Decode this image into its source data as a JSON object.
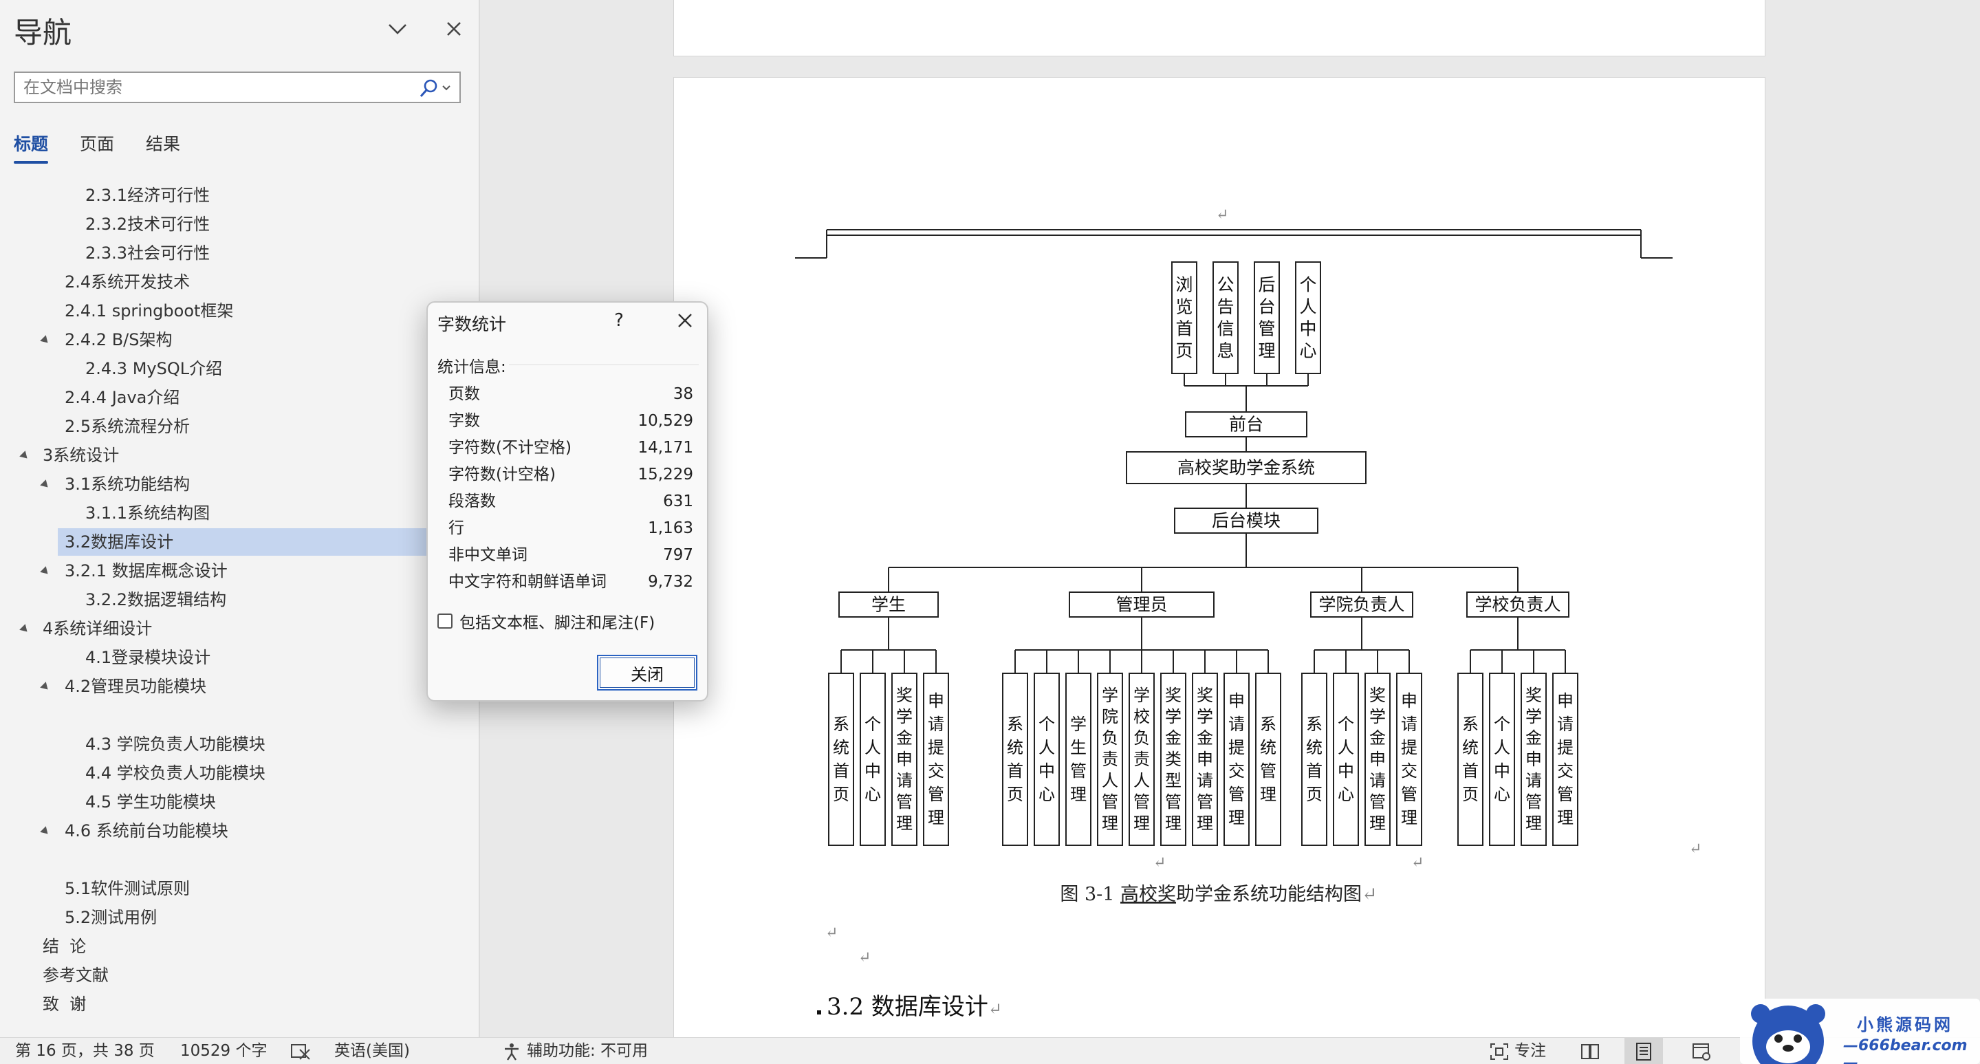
{
  "nav": {
    "title": "导航",
    "search_placeholder": "在文档中搜索",
    "tabs": [
      "标题",
      "页面",
      "结果"
    ],
    "headings": [
      {
        "label": "2.3.1经济可行性"
      },
      {
        "label": "2.3.2技术可行性"
      },
      {
        "label": "2.3.3社会可行性"
      },
      {
        "label": "2.4系统开发技术"
      },
      {
        "label": "2.4.1 springboot框架"
      },
      {
        "label": "2.4.2 B/S架构"
      },
      {
        "label": "2.4.3 MySQL介绍"
      },
      {
        "label": "2.4.4 Java介绍"
      },
      {
        "label": "2.5系统流程分析"
      },
      {
        "label": "3系统设计"
      },
      {
        "label": "3.1系统功能结构"
      },
      {
        "label": "3.1.1系统结构图"
      },
      {
        "label": "3.2数据库设计"
      },
      {
        "label": "3.2.1 数据库概念设计"
      },
      {
        "label": "3.2.2数据逻辑结构"
      },
      {
        "label": "4系统详细设计"
      },
      {
        "label": "4.1登录模块设计"
      },
      {
        "label": "4.2管理员功能模块"
      },
      {
        "label": "4.3 学院负责人功能模块"
      },
      {
        "label": "4.4 学校负责人功能模块"
      },
      {
        "label": "4.5 学生功能模块"
      },
      {
        "label": "4.6 系统前台功能模块"
      },
      {
        "label": "5.1软件测试原则"
      },
      {
        "label": "5.2测试用例"
      },
      {
        "label": "结  论"
      },
      {
        "label": "参考文献"
      },
      {
        "label": "致  谢"
      }
    ]
  },
  "dialog": {
    "title": "字数统计",
    "help": "?",
    "section": "统计信息:",
    "stats": [
      {
        "label": "页数",
        "value": "38"
      },
      {
        "label": "字数",
        "value": "10,529"
      },
      {
        "label": "字符数(不计空格)",
        "value": "14,171"
      },
      {
        "label": "字符数(计空格)",
        "value": "15,229"
      },
      {
        "label": "段落数",
        "value": "631"
      },
      {
        "label": "行",
        "value": "1,163"
      },
      {
        "label": "非中文单词",
        "value": "797"
      },
      {
        "label": "中文字符和朝鲜语单词",
        "value": "9,732"
      }
    ],
    "include_label": "包括文本框、脚注和尾注(F)",
    "close_label": "关闭"
  },
  "document": {
    "diagram": {
      "top_boxes": [
        "浏览首页",
        "公告信息",
        "后台管理",
        "个人中心"
      ],
      "front": "前台",
      "system": "高校奖助学金系统",
      "backend": "后台模块",
      "roles": [
        {
          "name": "学生",
          "items": [
            "系统首页",
            "个人中心",
            "奖学金申请管理",
            "申请提交管理"
          ]
        },
        {
          "name": "管理员",
          "items": [
            "系统首页",
            "个人中心",
            "学生管理",
            "学院负责人管理",
            "学校负责人管理",
            "奖学金类型管理",
            "奖学金申请管理",
            "申请提交管理",
            "系统管理"
          ]
        },
        {
          "name": "学院负责人",
          "items": [
            "系统首页",
            "个人中心",
            "奖学金申请管理",
            "申请提交管理"
          ]
        },
        {
          "name": "学校负责人",
          "items": [
            "系统首页",
            "个人中心",
            "奖学金申请管理",
            "申请提交管理"
          ]
        }
      ]
    },
    "caption_prefix": "图 3-1  ",
    "caption_underlined": "高校奖",
    "caption_rest": "助学金系统功能结构图",
    "section_heading": "3.2 数据库设计",
    "para_mark": "↵"
  },
  "statusbar": {
    "page": "第 16 页，共 38 页",
    "words": "10529 个字",
    "language": "英语(美国)",
    "accessibility": "辅助功能: 不可用",
    "focus": "专注"
  },
  "watermark": {
    "line1": "小熊源码网",
    "line2": "—666bear.com—"
  },
  "colors": {
    "accent": "#1f4fa3",
    "selected_heading": "#c5d5ef"
  }
}
